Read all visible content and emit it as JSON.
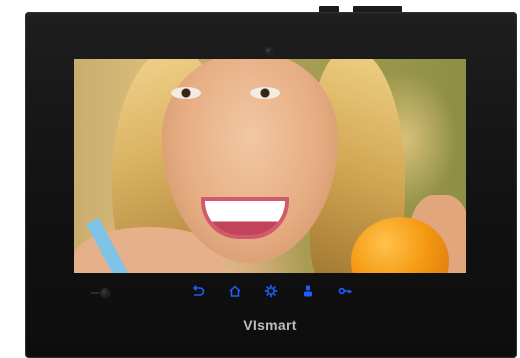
{
  "device": {
    "brand": "VIsmart",
    "screen_content": "video-feed",
    "accent_color": "#1f5fff"
  },
  "controls": [
    {
      "id": "back",
      "icon": "back-arrow-icon"
    },
    {
      "id": "home",
      "icon": "home-icon"
    },
    {
      "id": "settings",
      "icon": "gear-icon"
    },
    {
      "id": "intercom",
      "icon": "intercom-icon"
    },
    {
      "id": "unlock",
      "icon": "key-icon"
    }
  ]
}
